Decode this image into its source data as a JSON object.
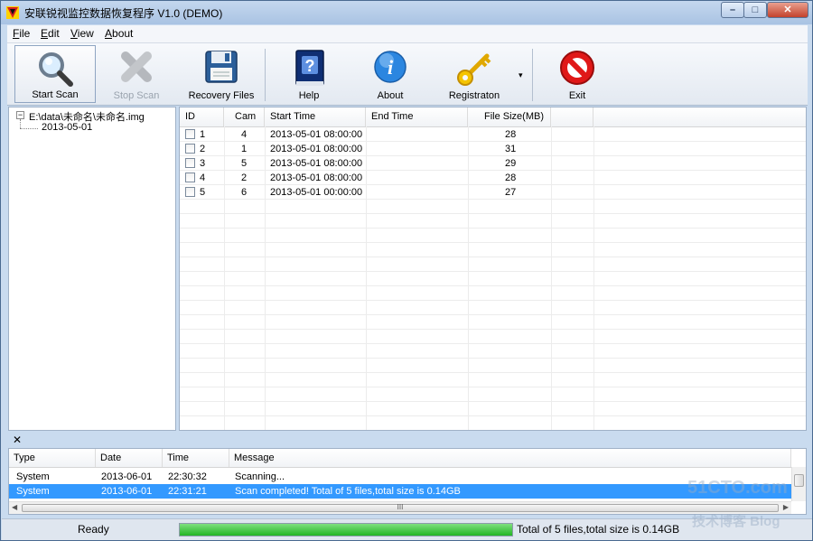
{
  "window": {
    "title": "安联锐视监控数据恢复程序 V1.0 (DEMO)",
    "controls": {
      "minimize": "–",
      "maximize": "□",
      "close": "✕"
    }
  },
  "menu": [
    {
      "label": "File",
      "mnemonic": "F",
      "rest": "ile"
    },
    {
      "label": "Edit",
      "mnemonic": "E",
      "rest": "dit"
    },
    {
      "label": "View",
      "mnemonic": "V",
      "rest": "iew"
    },
    {
      "label": "About",
      "mnemonic": "A",
      "rest": "bout"
    }
  ],
  "toolbar": {
    "start_scan": {
      "label": "Start Scan",
      "icon": "magnifier-icon",
      "state": "active"
    },
    "stop_scan": {
      "label": "Stop Scan",
      "icon": "stop-x-icon",
      "state": "disabled"
    },
    "recovery_files": {
      "label": "Recovery Files",
      "icon": "floppy-disk-icon"
    },
    "help": {
      "label": "Help",
      "icon": "help-book-icon"
    },
    "about": {
      "label": "About",
      "icon": "info-icon"
    },
    "registration": {
      "label": "Registraton",
      "icon": "key-icon"
    },
    "dropdown": "▾",
    "exit": {
      "label": "Exit",
      "icon": "no-entry-icon"
    }
  },
  "tree": {
    "root": "E:\\data\\未命名\\未命名.img",
    "expander": "−",
    "children": [
      "2013-05-01"
    ]
  },
  "file_list": {
    "columns": [
      "ID",
      "Cam",
      "Start Time",
      "End Time",
      "File Size(MB)"
    ],
    "rows": [
      {
        "id": "1",
        "cam": "4",
        "start": "2013-05-01 08:00:00",
        "end": "",
        "size": "28"
      },
      {
        "id": "2",
        "cam": "1",
        "start": "2013-05-01 08:00:00",
        "end": "",
        "size": "31"
      },
      {
        "id": "3",
        "cam": "5",
        "start": "2013-05-01 08:00:00",
        "end": "",
        "size": "29"
      },
      {
        "id": "4",
        "cam": "2",
        "start": "2013-05-01 08:00:00",
        "end": "",
        "size": "28"
      },
      {
        "id": "5",
        "cam": "6",
        "start": "2013-05-01 00:00:00",
        "end": "",
        "size": "27"
      }
    ]
  },
  "log": {
    "close": "✕",
    "columns": [
      "Type",
      "Date",
      "Time",
      "Message"
    ],
    "rows": [
      {
        "type": "System",
        "date": "2013-06-01",
        "time": "22:30:32",
        "message": "Scanning...",
        "selected": false
      },
      {
        "type": "System",
        "date": "2013-06-01",
        "time": "22:31:21",
        "message": "Scan completed! Total of 5 files,total size is 0.14GB",
        "selected": true
      }
    ],
    "scroll_grip": "III"
  },
  "status": {
    "ready": "Ready",
    "progress_fraction": 1.0,
    "total": "Total of 5 files,total size is 0.14GB"
  },
  "watermark": {
    "line1": "51CTO.com",
    "line2": "技术博客  Blog"
  },
  "colors": {
    "selection": "#3399ff",
    "progress": "#23b523"
  }
}
